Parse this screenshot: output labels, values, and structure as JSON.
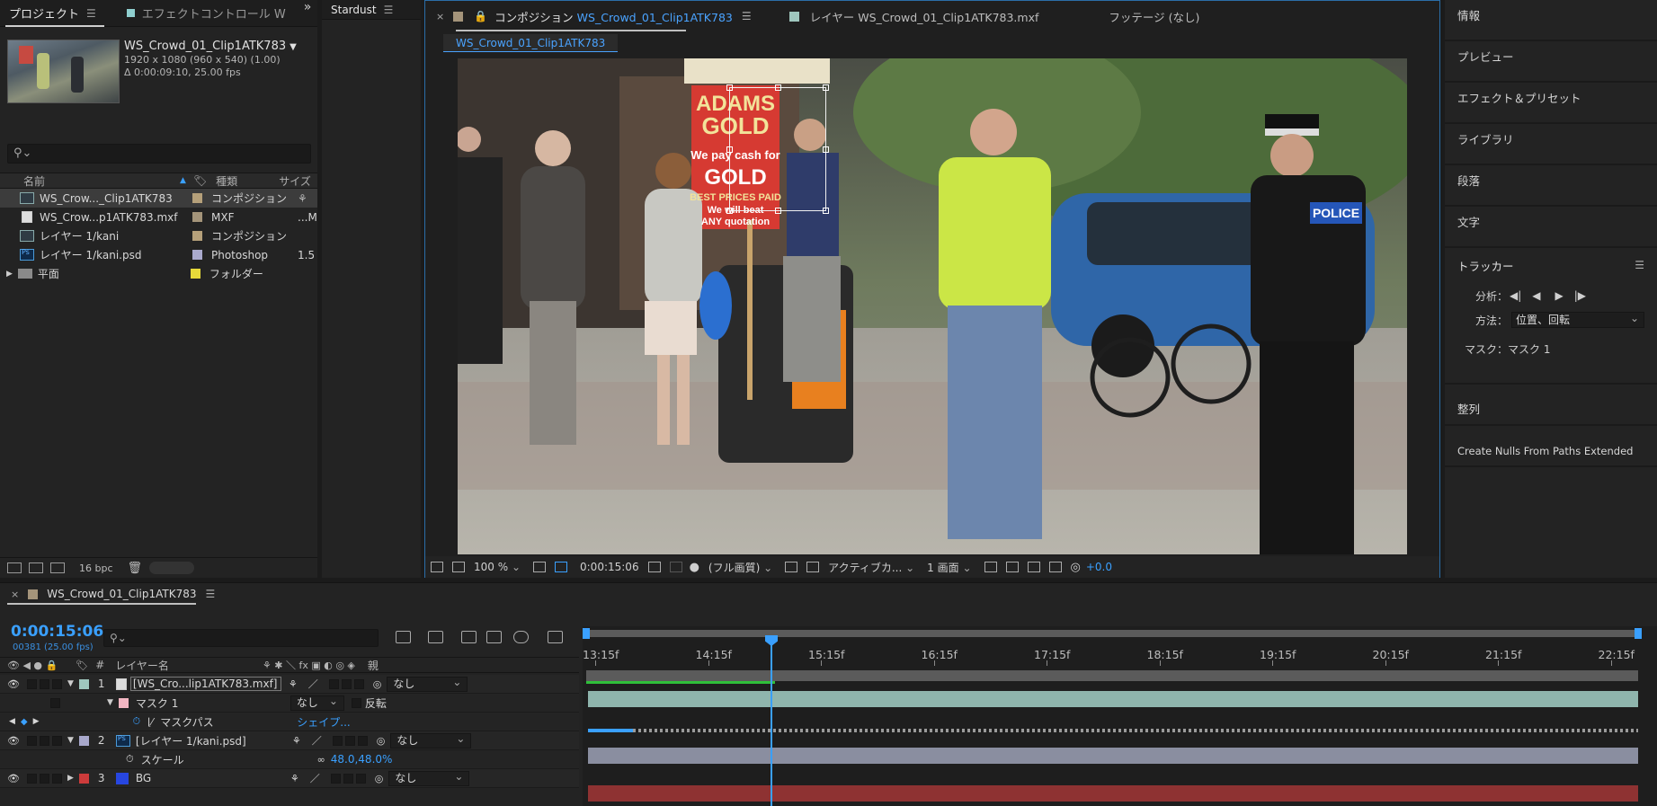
{
  "project": {
    "tabs": [
      {
        "label": "プロジェクト"
      },
      {
        "label": "エフェクトコントロール W"
      }
    ],
    "item": {
      "name": "WS_Crowd_01_Clip1ATK783",
      "dims": "1920 x 1080  (960 x 540) (1.00)",
      "duration": "Δ 0:00:09:10, 25.00 fps"
    },
    "search_placeholder": "⚲⌄",
    "columns": {
      "name": "名前",
      "type": "種類",
      "size": "サイズ"
    },
    "rows": [
      {
        "name": "WS_Crow..._Clip1ATK783",
        "type": "コンポジション",
        "size": "",
        "color": "#b5a07a",
        "icon": "composition-icon"
      },
      {
        "name": "WS_Crow...p1ATK783.mxf",
        "type": "MXF",
        "size": "...M",
        "color": "#a4947a",
        "icon": "mxf-file-icon"
      },
      {
        "name": "レイヤー 1/kani",
        "type": "コンポジション",
        "size": "",
        "color": "#b5a07a",
        "icon": "composition-icon"
      },
      {
        "name": "レイヤー 1/kani.psd",
        "type": "Photoshop",
        "size": "1.5",
        "color": "#a9a9cc",
        "icon": "photoshop-file-icon"
      },
      {
        "name": "平面",
        "type": "フォルダー",
        "size": "",
        "color": "#e6d93a",
        "icon": "folder-icon"
      }
    ],
    "bpc": "16 bpc"
  },
  "stardust": {
    "title": "Stardust"
  },
  "comp": {
    "tabs": [
      {
        "prefix": "コンポジション",
        "name": "WS_Crowd_01_Clip1ATK783"
      },
      {
        "prefix": "レイヤー",
        "name": "WS_Crowd_01_Clip1ATK783.mxf"
      },
      {
        "prefix": "フッテージ",
        "name": "(なし)"
      }
    ],
    "subtab": "WS_Crowd_01_Clip1ATK783",
    "bar": {
      "zoom": "100 %",
      "timecode": "0:00:15:06",
      "resolution": "(フル画質)",
      "camera": "アクティブカ...",
      "views": "1 画面",
      "exposure": "+0.0"
    },
    "sign": {
      "line1": "ADAMS",
      "line2": "GOLD",
      "line3": "We pay cash for",
      "line4": "GOLD",
      "line5": "BEST PRICES PAID",
      "line6": "We will beat",
      "line7": "ANY quotation"
    },
    "police_label": "POLICE"
  },
  "right_panels": {
    "info": "情報",
    "preview": "プレビュー",
    "effects": "エフェクト＆プリセット",
    "library": "ライブラリ",
    "paragraph": "段落",
    "character": "文字",
    "tracker": {
      "title": "トラッカー",
      "analyze_label": "分析：",
      "method_label": "方法：",
      "method_value": "位置、回転",
      "mask_label": "マスク：マスク 1"
    },
    "align": "整列",
    "create_nulls": "Create Nulls From Paths Extended"
  },
  "timeline": {
    "comp_name": "WS_Crowd_01_Clip1ATK783",
    "timecode": "0:00:15:06",
    "frames": "00381 (25.00 fps)",
    "columns": {
      "layer_name": "レイヤー名",
      "parent": "親"
    },
    "ruler": [
      "13:15f",
      "14:15f",
      "15:15f",
      "16:15f",
      "17:15f",
      "18:15f",
      "19:15f",
      "20:15f",
      "21:15f",
      "22:15f"
    ],
    "layers": [
      {
        "num": "1",
        "name": "[WS_Cro...lip1ATK783.mxf]",
        "parent": "なし",
        "color": "#9fc7be",
        "bar_color": "#8fb5ad"
      },
      {
        "num": "2",
        "name": "[レイヤー 1/kani.psd]",
        "parent": "なし",
        "color": "#a9a9cc",
        "bar_color": "#8a8ea0"
      },
      {
        "num": "3",
        "name": "BG",
        "parent": "なし",
        "color": "#cc3b3b",
        "bar_color": "#8e3232"
      }
    ],
    "mask": {
      "name": "マスク 1",
      "mode": "なし",
      "invert": "反転",
      "path_label": "マスクパス",
      "path_value": "シェイプ..."
    },
    "scale": {
      "label": "スケール",
      "value": "48.0,48.0",
      "unit": "%"
    }
  }
}
